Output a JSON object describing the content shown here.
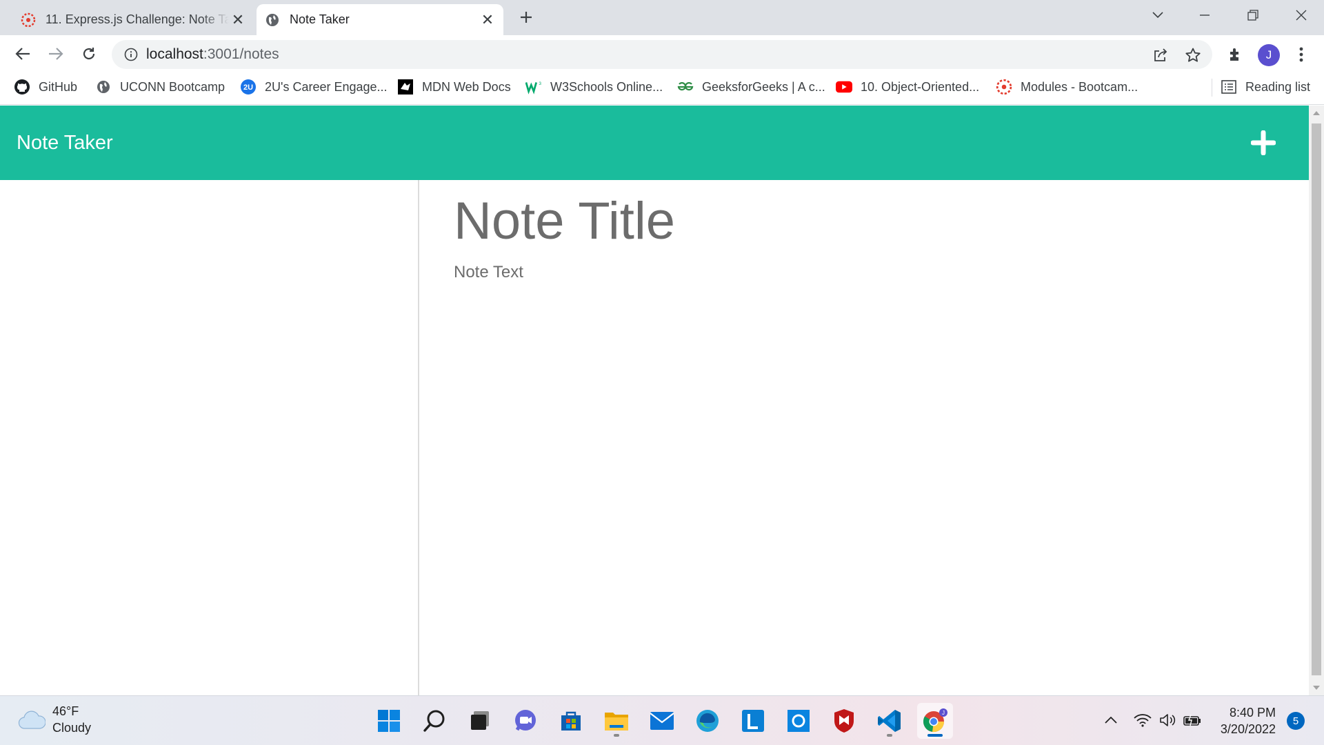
{
  "browser": {
    "tabs": [
      {
        "title": "11. Express.js Challenge: Note Taker",
        "icon": "canvas-logo-icon",
        "active": false
      },
      {
        "title": "Note Taker",
        "icon": "globe-icon",
        "active": true
      }
    ],
    "url_host": "localhost",
    "url_path": ":3001/notes",
    "profile_initial": "J",
    "bookmarks": [
      {
        "label": "GitHub",
        "icon": "github-icon"
      },
      {
        "label": "UCONN Bootcamp",
        "icon": "globe-icon"
      },
      {
        "label": "2U's Career Engage...",
        "icon": "2u-logo-icon"
      },
      {
        "label": "MDN Web Docs",
        "icon": "mdn-logo-icon"
      },
      {
        "label": "W3Schools Online...",
        "icon": "w3schools-icon"
      },
      {
        "label": "GeeksforGeeks | A c...",
        "icon": "geeksforgeeks-icon"
      },
      {
        "label": "10. Object-Oriented...",
        "icon": "youtube-icon"
      },
      {
        "label": "Modules - Bootcam...",
        "icon": "canvas-logo-icon"
      }
    ],
    "reading_list": "Reading list"
  },
  "app": {
    "brand": "Note Taker",
    "add_icon": "plus-icon",
    "note_title_placeholder": "Note Title",
    "note_text_placeholder": "Note Text",
    "accent_color": "#1abc9c"
  },
  "taskbar": {
    "weather_temp": "46°F",
    "weather_desc": "Cloudy",
    "time": "8:40 PM",
    "date": "3/20/2022",
    "notification_count": "5",
    "apps": [
      "start-icon",
      "search-icon",
      "task-view-icon",
      "chat-icon",
      "store-icon",
      "file-explorer-icon",
      "mail-icon",
      "edge-icon",
      "lightbox-icon",
      "cortana-icon",
      "mcafee-icon",
      "vscode-icon",
      "chrome-icon"
    ]
  }
}
